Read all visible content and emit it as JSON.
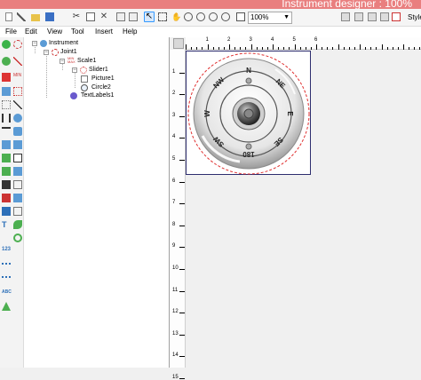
{
  "window": {
    "title": "Instrument designer : 100%"
  },
  "toolbar": {
    "buttons": [
      "new-icon",
      "wand-icon",
      "open-icon",
      "save-icon",
      "cut-icon",
      "copy-icon",
      "paste-icon",
      "delete-icon",
      "undo-icon",
      "redo-icon",
      "pointer-icon",
      "crop-icon",
      "hand-icon",
      "zoom-in-icon",
      "zoom-out-icon",
      "zoom-fit-icon",
      "zoom-100-icon",
      "zoom-page-icon"
    ],
    "zoom_value": "100%",
    "style_label": "Style"
  },
  "menu": [
    "File",
    "Edit",
    "View",
    "Tool",
    "Insert",
    "Help"
  ],
  "tree": [
    {
      "label": "Instrument",
      "toggle": "−",
      "icon": "instrument-icon"
    },
    {
      "label": "Joint1",
      "toggle": "−",
      "icon": "joint-icon"
    },
    {
      "label": "Scale1",
      "toggle": "−",
      "icon": "scale-icon"
    },
    {
      "label": "Slider1",
      "toggle": "−",
      "icon": "slider-icon"
    },
    {
      "label": "Picture1",
      "toggle": "",
      "icon": "picture-icon"
    },
    {
      "label": "Circle2",
      "toggle": "",
      "icon": "circle-icon"
    },
    {
      "label": "TextLabels1",
      "toggle": "",
      "icon": "textlabels-icon"
    }
  ],
  "ruler": {
    "top": [
      "1",
      "2",
      "3",
      "4",
      "5",
      "6"
    ],
    "left": [
      "1",
      "2",
      "3",
      "4",
      "5",
      "6",
      "7",
      "8",
      "9",
      "10",
      "11",
      "12",
      "13",
      "14",
      "15"
    ]
  },
  "compass": {
    "labels": [
      "N",
      "NE",
      "E",
      "SE",
      "180",
      "SW",
      "W",
      "NW"
    ]
  },
  "colors": {
    "title_bar": "#e97f7f",
    "dashed_circle": "#e03030",
    "frame_border": "#2d2d6e"
  }
}
